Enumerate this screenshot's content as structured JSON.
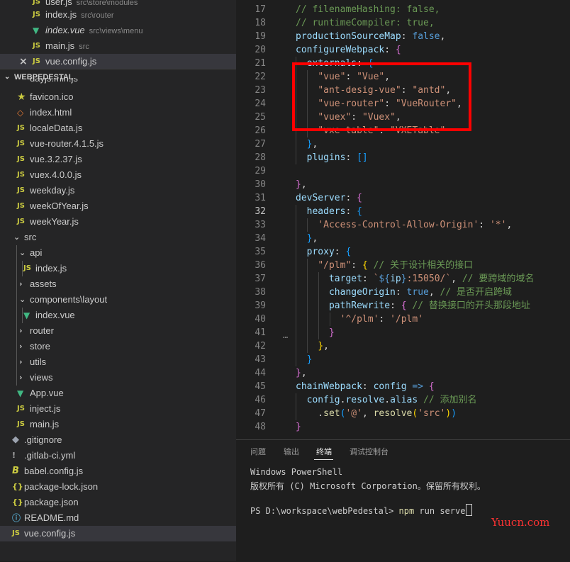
{
  "explorer": {
    "open_editors": [
      {
        "label": "user.js",
        "desc": "src\\store\\modules",
        "icon": "js-icon"
      },
      {
        "label": "index.js",
        "desc": "src\\router",
        "icon": "js-icon"
      },
      {
        "label": "index.vue",
        "desc": "src\\views\\menu",
        "icon": "vue-icon"
      },
      {
        "label": "main.js",
        "desc": "src",
        "icon": "js-icon"
      },
      {
        "label": "vue.config.js",
        "desc": "",
        "icon": "js-icon"
      }
    ],
    "close_glyph": "×",
    "section_title": "WEBPEDESTAL",
    "partial_item": "dayjs.min.js",
    "files": [
      {
        "label": "favicon.ico",
        "icon": "star-icon",
        "glyph": "★"
      },
      {
        "label": "index.html",
        "icon": "html-icon",
        "glyph": "◇"
      },
      {
        "label": "localeData.js",
        "icon": "js-icon",
        "glyph": "JS"
      },
      {
        "label": "vue-router.4.1.5.js",
        "icon": "js-icon",
        "glyph": "JS"
      },
      {
        "label": "vue.3.2.37.js",
        "icon": "js-icon",
        "glyph": "JS"
      },
      {
        "label": "vuex.4.0.0.js",
        "icon": "js-icon",
        "glyph": "JS"
      },
      {
        "label": "weekday.js",
        "icon": "js-icon",
        "glyph": "JS"
      },
      {
        "label": "weekOfYear.js",
        "icon": "js-icon",
        "glyph": "JS"
      },
      {
        "label": "weekYear.js",
        "icon": "js-icon",
        "glyph": "JS"
      },
      {
        "label": "src",
        "icon": "chevron-down-icon",
        "glyph": "⌄"
      },
      {
        "label": "api",
        "icon": "chevron-down-icon",
        "glyph": "⌄"
      },
      {
        "label": "index.js",
        "icon": "js-icon",
        "glyph": "JS"
      },
      {
        "label": "assets",
        "icon": "chevron-right-icon",
        "glyph": "›"
      },
      {
        "label": "components\\layout",
        "icon": "chevron-down-icon",
        "glyph": "⌄"
      },
      {
        "label": "index.vue",
        "icon": "vue-icon",
        "glyph": "▼"
      },
      {
        "label": "router",
        "icon": "chevron-right-icon",
        "glyph": "›"
      },
      {
        "label": "store",
        "icon": "chevron-right-icon",
        "glyph": "›"
      },
      {
        "label": "utils",
        "icon": "chevron-right-icon",
        "glyph": "›"
      },
      {
        "label": "views",
        "icon": "chevron-right-icon",
        "glyph": "›"
      },
      {
        "label": "App.vue",
        "icon": "vue-icon",
        "glyph": "▼"
      },
      {
        "label": "inject.js",
        "icon": "js-icon",
        "glyph": "JS"
      },
      {
        "label": "main.js",
        "icon": "js-icon",
        "glyph": "JS"
      },
      {
        "label": ".gitignore",
        "icon": "git-icon",
        "glyph": "◆"
      },
      {
        "label": ".gitlab-ci.yml",
        "icon": "gitlab-icon",
        "glyph": "!"
      },
      {
        "label": "babel.config.js",
        "icon": "babel-icon",
        "glyph": "B"
      },
      {
        "label": "package-lock.json",
        "icon": "json-icon",
        "glyph": "{}"
      },
      {
        "label": "package.json",
        "icon": "json-icon",
        "glyph": "{}"
      },
      {
        "label": "README.md",
        "icon": "info-icon",
        "glyph": "ⓘ"
      },
      {
        "label": "vue.config.js",
        "icon": "js-icon",
        "glyph": "JS"
      }
    ]
  },
  "editor": {
    "active_line": 32,
    "lines": [
      {
        "n": 17,
        "tokens": [
          [
            "cm",
            "// filenameHashing: false,"
          ]
        ]
      },
      {
        "n": 18,
        "tokens": [
          [
            "cm",
            "// runtimeCompiler: true,"
          ]
        ]
      },
      {
        "n": 19,
        "tokens": [
          [
            "key",
            "productionSourceMap"
          ],
          [
            "pun",
            ": "
          ],
          [
            "kw",
            "false"
          ],
          [
            "pun",
            ","
          ]
        ]
      },
      {
        "n": 20,
        "tokens": [
          [
            "key",
            "configureWebpack"
          ],
          [
            "pun",
            ": "
          ],
          [
            "b1",
            "{"
          ]
        ]
      },
      {
        "n": 21,
        "tokens": [
          [
            "pun",
            "  "
          ],
          [
            "key",
            "externals"
          ],
          [
            "pun",
            ": "
          ],
          [
            "b2",
            "{"
          ]
        ]
      },
      {
        "n": 22,
        "tokens": [
          [
            "pun",
            "    "
          ],
          [
            "str",
            "\"vue\""
          ],
          [
            "pun",
            ": "
          ],
          [
            "str",
            "\"Vue\""
          ],
          [
            "pun",
            ","
          ]
        ]
      },
      {
        "n": 23,
        "tokens": [
          [
            "pun",
            "    "
          ],
          [
            "str",
            "\"ant-desig-vue\""
          ],
          [
            "pun",
            ": "
          ],
          [
            "str",
            "\"antd\""
          ],
          [
            "pun",
            ","
          ]
        ]
      },
      {
        "n": 24,
        "tokens": [
          [
            "pun",
            "    "
          ],
          [
            "str",
            "\"vue-router\""
          ],
          [
            "pun",
            ": "
          ],
          [
            "str",
            "\"VueRouter\""
          ],
          [
            "pun",
            ","
          ]
        ]
      },
      {
        "n": 25,
        "tokens": [
          [
            "pun",
            "    "
          ],
          [
            "str",
            "\"vuex\""
          ],
          [
            "pun",
            ": "
          ],
          [
            "str",
            "\"Vuex\""
          ],
          [
            "pun",
            ","
          ]
        ]
      },
      {
        "n": 26,
        "tokens": [
          [
            "pun",
            "    "
          ],
          [
            "str",
            "\"vxe-table\""
          ],
          [
            "pun",
            ": "
          ],
          [
            "str",
            "\"VXETable\""
          ]
        ]
      },
      {
        "n": 27,
        "tokens": [
          [
            "pun",
            "  "
          ],
          [
            "b2",
            "}"
          ],
          [
            "pun",
            ","
          ]
        ]
      },
      {
        "n": 28,
        "tokens": [
          [
            "pun",
            "  "
          ],
          [
            "key",
            "plugins"
          ],
          [
            "pun",
            ": "
          ],
          [
            "b2",
            "[]"
          ]
        ]
      },
      {
        "n": 29,
        "tokens": []
      },
      {
        "n": 30,
        "tokens": [
          [
            "b1",
            "}"
          ],
          [
            "pun",
            ","
          ]
        ]
      },
      {
        "n": 31,
        "tokens": [
          [
            "key",
            "devServer"
          ],
          [
            "pun",
            ": "
          ],
          [
            "b1",
            "{"
          ]
        ]
      },
      {
        "n": 32,
        "tokens": [
          [
            "pun",
            "  "
          ],
          [
            "key",
            "headers"
          ],
          [
            "pun",
            ": "
          ],
          [
            "b2",
            "{"
          ]
        ]
      },
      {
        "n": 33,
        "tokens": [
          [
            "pun",
            "    "
          ],
          [
            "str",
            "'Access-Control-Allow-Origin'"
          ],
          [
            "pun",
            ": "
          ],
          [
            "str",
            "'*'"
          ],
          [
            "pun",
            ","
          ]
        ]
      },
      {
        "n": 34,
        "tokens": [
          [
            "pun",
            "  "
          ],
          [
            "b2",
            "}"
          ],
          [
            "pun",
            ","
          ]
        ]
      },
      {
        "n": 35,
        "tokens": [
          [
            "pun",
            "  "
          ],
          [
            "key",
            "proxy"
          ],
          [
            "pun",
            ": "
          ],
          [
            "b2",
            "{"
          ]
        ]
      },
      {
        "n": 36,
        "tokens": [
          [
            "pun",
            "    "
          ],
          [
            "str",
            "\"/plm\""
          ],
          [
            "pun",
            ": "
          ],
          [
            "b3",
            "{"
          ],
          [
            "pun",
            " "
          ],
          [
            "cm",
            "// 关于设计相关的接口"
          ]
        ]
      },
      {
        "n": 37,
        "tokens": [
          [
            "pun",
            "      "
          ],
          [
            "key",
            "target"
          ],
          [
            "pun",
            ": "
          ],
          [
            "str",
            "`"
          ],
          [
            "kw",
            "${"
          ],
          [
            "key",
            "ip"
          ],
          [
            "kw",
            "}"
          ],
          [
            "str",
            ":15050/`"
          ],
          [
            "pun",
            ", "
          ],
          [
            "cm",
            "// 要跨域的域名"
          ]
        ]
      },
      {
        "n": 38,
        "tokens": [
          [
            "pun",
            "      "
          ],
          [
            "key",
            "changeOrigin"
          ],
          [
            "pun",
            ": "
          ],
          [
            "kw",
            "true"
          ],
          [
            "pun",
            ", "
          ],
          [
            "cm",
            "// 是否开启跨域"
          ]
        ]
      },
      {
        "n": 39,
        "tokens": [
          [
            "pun",
            "      "
          ],
          [
            "key",
            "pathRewrite"
          ],
          [
            "pun",
            ": "
          ],
          [
            "b1",
            "{"
          ],
          [
            "pun",
            " "
          ],
          [
            "cm",
            "// 替换接口的开头那段地址"
          ]
        ]
      },
      {
        "n": 40,
        "tokens": [
          [
            "pun",
            "        "
          ],
          [
            "str",
            "'^/plm'"
          ],
          [
            "pun",
            ": "
          ],
          [
            "str",
            "'/plm'"
          ]
        ]
      },
      {
        "n": 41,
        "tokens": [
          [
            "pun",
            "      "
          ],
          [
            "b1",
            "}"
          ]
        ]
      },
      {
        "n": 42,
        "tokens": [
          [
            "pun",
            "    "
          ],
          [
            "b3",
            "}"
          ],
          [
            "pun",
            ","
          ]
        ]
      },
      {
        "n": 43,
        "tokens": [
          [
            "pun",
            "  "
          ],
          [
            "b2",
            "}"
          ]
        ]
      },
      {
        "n": 44,
        "tokens": [
          [
            "b1",
            "}"
          ],
          [
            "pun",
            ","
          ]
        ]
      },
      {
        "n": 45,
        "tokens": [
          [
            "key",
            "chainWebpack"
          ],
          [
            "pun",
            ": "
          ],
          [
            "key",
            "config"
          ],
          [
            "pun",
            " "
          ],
          [
            "kw",
            "=>"
          ],
          [
            "pun",
            " "
          ],
          [
            "b1",
            "{"
          ]
        ]
      },
      {
        "n": 46,
        "tokens": [
          [
            "pun",
            "  "
          ],
          [
            "key",
            "config"
          ],
          [
            "pun",
            "."
          ],
          [
            "key",
            "resolve"
          ],
          [
            "pun",
            "."
          ],
          [
            "key",
            "alias"
          ],
          [
            "pun",
            " "
          ],
          [
            "cm",
            "// 添加别名"
          ]
        ]
      },
      {
        "n": 47,
        "tokens": [
          [
            "pun",
            "    ."
          ],
          [
            "fn",
            "set"
          ],
          [
            "b2",
            "("
          ],
          [
            "str",
            "'@'"
          ],
          [
            "pun",
            ", "
          ],
          [
            "fn",
            "resolve"
          ],
          [
            "b3",
            "("
          ],
          [
            "str",
            "'src'"
          ],
          [
            "b3",
            ")"
          ],
          [
            "b2",
            ")"
          ]
        ]
      },
      {
        "n": 48,
        "tokens": [
          [
            "b1",
            "}"
          ]
        ]
      }
    ],
    "fold_marker": "…"
  },
  "panel": {
    "tabs": [
      "问题",
      "输出",
      "终端",
      "调试控制台"
    ],
    "active_tab": "终端",
    "terminal": {
      "line1": "Windows PowerShell",
      "line2": "版权所有 (C) Microsoft Corporation。保留所有权利。",
      "prompt": "PS D:\\workspace\\webPedestal> ",
      "command": "npm",
      "args": " run serve"
    }
  },
  "watermark": "Yuucn.com"
}
